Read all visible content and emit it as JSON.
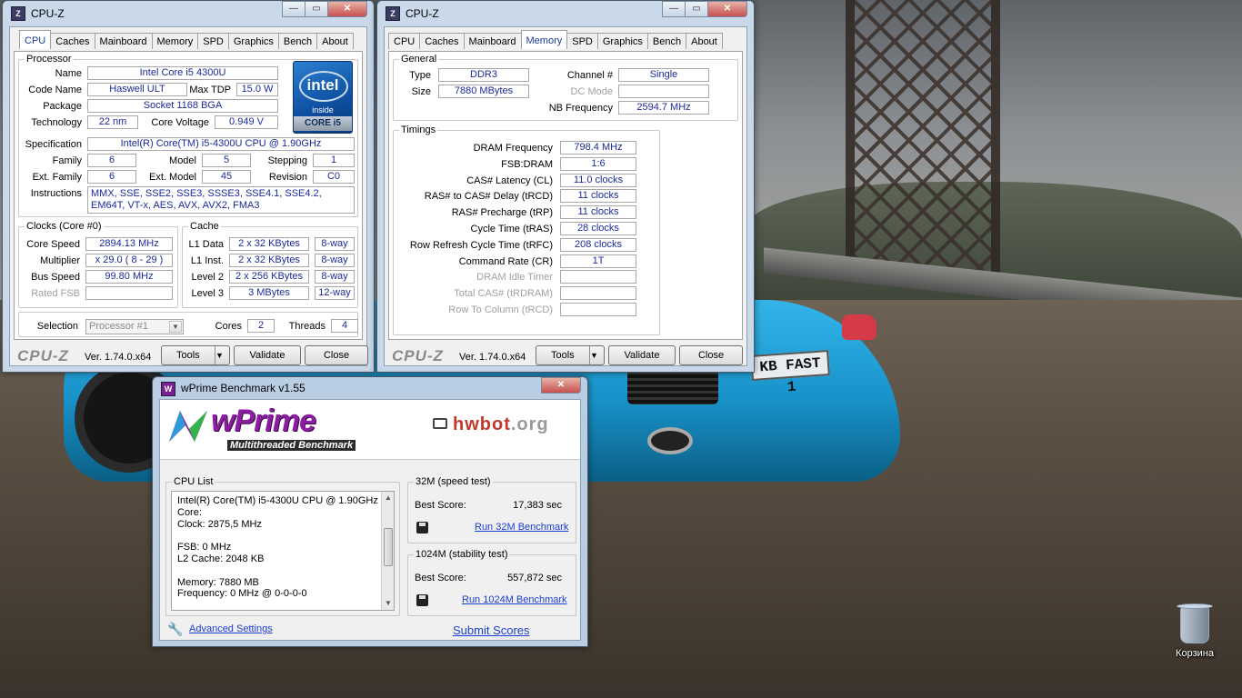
{
  "cpuz1": {
    "title": "CPU-Z",
    "tabs": [
      "CPU",
      "Caches",
      "Mainboard",
      "Memory",
      "SPD",
      "Graphics",
      "Bench",
      "About"
    ],
    "active_tab": "CPU",
    "processor": {
      "legend": "Processor",
      "name_label": "Name",
      "name": "Intel Core i5 4300U",
      "codename_label": "Code Name",
      "codename": "Haswell ULT",
      "maxtdp_label": "Max TDP",
      "maxtdp": "15.0 W",
      "package_label": "Package",
      "package": "Socket 1168 BGA",
      "technology_label": "Technology",
      "technology": "22 nm",
      "corevoltage_label": "Core Voltage",
      "corevoltage": "0.949 V",
      "spec_label": "Specification",
      "spec": "Intel(R) Core(TM) i5-4300U CPU @ 1.90GHz",
      "family_label": "Family",
      "family": "6",
      "model_label": "Model",
      "model": "5",
      "stepping_label": "Stepping",
      "stepping": "1",
      "extfamily_label": "Ext. Family",
      "extfamily": "6",
      "extmodel_label": "Ext. Model",
      "extmodel": "45",
      "revision_label": "Revision",
      "revision": "C0",
      "instructions_label": "Instructions",
      "instructions": "MMX, SSE, SSE2, SSE3, SSSE3, SSE4.1, SSE4.2, EM64T, VT-x, AES, AVX, AVX2, FMA3"
    },
    "intel_badge": {
      "brand": "intel",
      "inside": "inside",
      "core": "CORE i5"
    },
    "clocks": {
      "legend": "Clocks (Core #0)",
      "corespeed_label": "Core Speed",
      "corespeed": "2894.13 MHz",
      "multiplier_label": "Multiplier",
      "multiplier": "x 29.0 ( 8 - 29 )",
      "busspeed_label": "Bus Speed",
      "busspeed": "99.80 MHz",
      "ratedfsb_label": "Rated FSB",
      "ratedfsb": ""
    },
    "cache": {
      "legend": "Cache",
      "l1data_label": "L1 Data",
      "l1data": "2 x 32 KBytes",
      "l1data_way": "8-way",
      "l1inst_label": "L1 Inst.",
      "l1inst": "2 x 32 KBytes",
      "l1inst_way": "8-way",
      "level2_label": "Level 2",
      "level2": "2 x 256 KBytes",
      "level2_way": "8-way",
      "level3_label": "Level 3",
      "level3": "3 MBytes",
      "level3_way": "12-way"
    },
    "selection": {
      "label": "Selection",
      "value": "Processor #1",
      "cores_label": "Cores",
      "cores": "2",
      "threads_label": "Threads",
      "threads": "4"
    },
    "footer": {
      "brand": "CPU-Z",
      "version": "Ver. 1.74.0.x64",
      "tools": "Tools",
      "validate": "Validate",
      "close": "Close"
    }
  },
  "cpuz2": {
    "title": "CPU-Z",
    "tabs": [
      "CPU",
      "Caches",
      "Mainboard",
      "Memory",
      "SPD",
      "Graphics",
      "Bench",
      "About"
    ],
    "active_tab": "Memory",
    "general": {
      "legend": "General",
      "type_label": "Type",
      "type": "DDR3",
      "size_label": "Size",
      "size": "7880 MBytes",
      "channel_label": "Channel #",
      "channel": "Single",
      "dcmode_label": "DC Mode",
      "dcmode": "",
      "nbfreq_label": "NB Frequency",
      "nbfreq": "2594.7 MHz"
    },
    "timings": {
      "legend": "Timings",
      "rows": [
        {
          "label": "DRAM Frequency",
          "value": "798.4 MHz",
          "dim": false
        },
        {
          "label": "FSB:DRAM",
          "value": "1:6",
          "dim": false
        },
        {
          "label": "CAS# Latency (CL)",
          "value": "11.0 clocks",
          "dim": false
        },
        {
          "label": "RAS# to CAS# Delay (tRCD)",
          "value": "11 clocks",
          "dim": false
        },
        {
          "label": "RAS# Precharge (tRP)",
          "value": "11 clocks",
          "dim": false
        },
        {
          "label": "Cycle Time (tRAS)",
          "value": "28 clocks",
          "dim": false
        },
        {
          "label": "Row Refresh Cycle Time (tRFC)",
          "value": "208 clocks",
          "dim": false
        },
        {
          "label": "Command Rate (CR)",
          "value": "1T",
          "dim": false
        },
        {
          "label": "DRAM Idle Timer",
          "value": "",
          "dim": true
        },
        {
          "label": "Total CAS# (tRDRAM)",
          "value": "",
          "dim": true
        },
        {
          "label": "Row To Column (tRCD)",
          "value": "",
          "dim": true
        }
      ]
    },
    "footer": {
      "brand": "CPU-Z",
      "version": "Ver. 1.74.0.x64",
      "tools": "Tools",
      "validate": "Validate",
      "close": "Close"
    }
  },
  "wprime": {
    "title": "wPrime Benchmark v1.55",
    "logo": "wPrime",
    "subtitle": "Multithreaded Benchmark",
    "hwbot": "hwbot",
    "hwbot_tld": ".org",
    "cpu_list": {
      "legend": "CPU List",
      "lines": [
        "Intel(R) Core(TM) i5-4300U CPU @ 1.90GHz",
        "Core:",
        "Clock: 2875,5 MHz",
        "",
        "FSB: 0 MHz",
        "L2 Cache: 2048 KB",
        "",
        "Memory: 7880 MB",
        "Frequency: 0 MHz @ 0-0-0-0"
      ]
    },
    "test32": {
      "legend": "32M (speed test)",
      "score_label": "Best Score:",
      "score": "17,383 sec",
      "run": "Run 32M Benchmark"
    },
    "test1024": {
      "legend": "1024M (stability test)",
      "score_label": "Best Score:",
      "score": "557,872 sec",
      "run": "Run 1024M Benchmark"
    },
    "advanced": "Advanced Settings",
    "submit": "Submit Scores"
  },
  "desktop": {
    "recycle_bin": "Корзина",
    "plate": "KB FAST 1"
  }
}
